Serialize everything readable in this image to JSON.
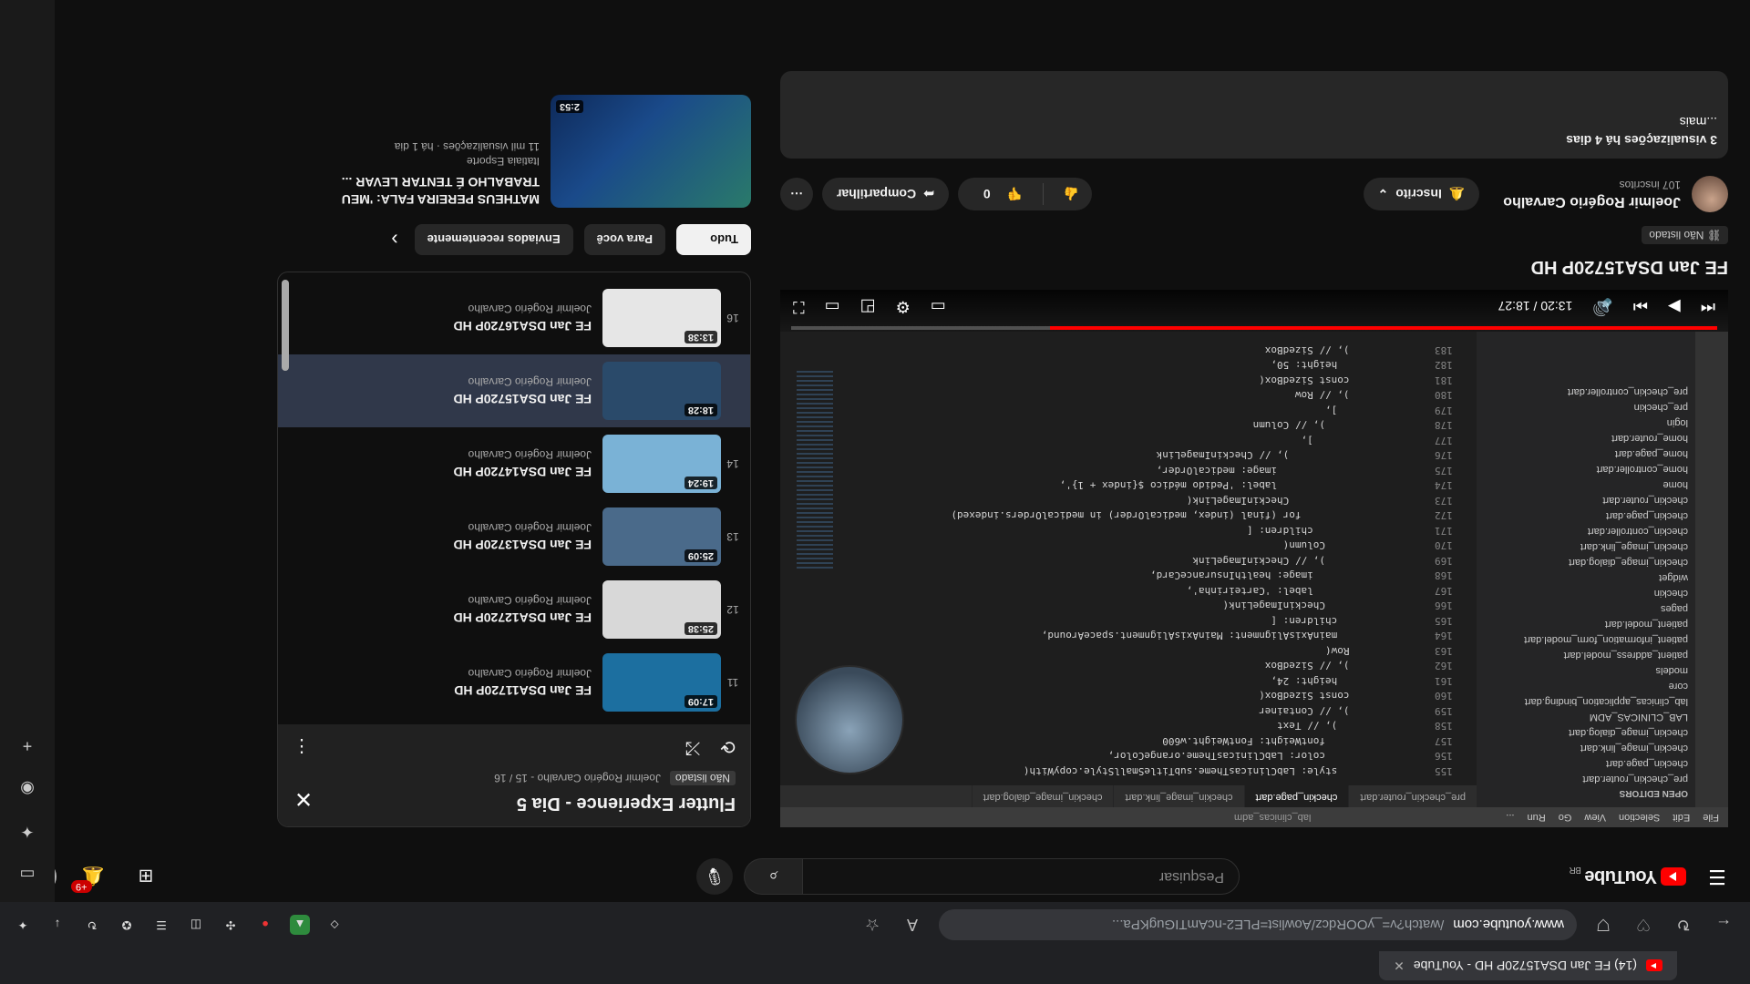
{
  "browser": {
    "tab_title": "(14) FE Jan DSA15720P HD - YouTube",
    "url_host": "www.youtube.com",
    "url_path": "/watch?v=_yOORdcz/Aowlist=PLE2-ncAmTIGugKPa..."
  },
  "header": {
    "logo_text": "YouTube",
    "region": "BR",
    "search_placeholder": "Pesquisar",
    "notifications_count": "+9"
  },
  "player": {
    "menu": [
      "File",
      "Edit",
      "Selection",
      "View",
      "Go",
      "Run",
      "..."
    ],
    "window_title": "lab_clinicas_adm",
    "explorer_header": "OPEN EDITORS",
    "explorer_items": [
      "pre_checkin_router.dart",
      "checkin_page.dart",
      "checkin_image_link.dart",
      "checkin_image_dialog.dart",
      "LAB_CLINICAS_ADM",
      "lab_clinicas_application_binding.dart",
      "core",
      "models",
      "patient_address_model.dart",
      "patient_information_form_model.dart",
      "patient_model.dart",
      "pages",
      "checkin",
      "widget",
      "checkin_image_dialog.dart",
      "checkin_image_link.dart",
      "checkin_controller.dart",
      "checkin_page.dart",
      "checkin_router.dart",
      "home",
      "home_controller.dart",
      "home_page.dart",
      "home_router.dart",
      "login",
      "pre_checkin",
      "pre_checkin_controller.dart"
    ],
    "editor_tabs": [
      "pre_checkin_router.dart",
      "checkin_page.dart",
      "checkin_image_link.dart",
      "checkin_image_dialog.dart"
    ],
    "code_lines": [
      {
        "n": "155",
        "t": "              style: LabClinicasTheme.subTitleSmallStyle.copyWith("
      },
      {
        "n": "156",
        "t": "                color: LabClinicasTheme.orangeColor,"
      },
      {
        "n": "157",
        "t": "                fontWeight: FontWeight.w600"
      },
      {
        "n": "158",
        "t": "              ), // Text"
      },
      {
        "n": "159",
        "t": "            ), // Container"
      },
      {
        "n": "160",
        "t": "            const SizedBox("
      },
      {
        "n": "161",
        "t": "              height: 24,"
      },
      {
        "n": "162",
        "t": "            ), // SizedBox"
      },
      {
        "n": "163",
        "t": "            Row("
      },
      {
        "n": "164",
        "t": "              mainAxisAlignment: MainAxisAlignment.spaceAround,"
      },
      {
        "n": "165",
        "t": "              children: ["
      },
      {
        "n": "166",
        "t": "                CheckinImageLink("
      },
      {
        "n": "167",
        "t": "                  label: 'Carteirinha',"
      },
      {
        "n": "168",
        "t": "                  image: healthInsuranceCard,"
      },
      {
        "n": "169",
        "t": "                ), // CheckinImageLink"
      },
      {
        "n": "170",
        "t": "                Column("
      },
      {
        "n": "171",
        "t": "                  children: ["
      },
      {
        "n": "172",
        "t": "                    for (final (index, medicalOrder) in medicalOrders.indexed)"
      },
      {
        "n": "173",
        "t": "                      CheckinImageLink("
      },
      {
        "n": "174",
        "t": "                        label: 'Pedido médico ${index + 1}',"
      },
      {
        "n": "175",
        "t": "                        image: medicalOrder,"
      },
      {
        "n": "176",
        "t": "                      ), // CheckinImageLink"
      },
      {
        "n": "177",
        "t": "                  ],"
      },
      {
        "n": "178",
        "t": "                ), // Column"
      },
      {
        "n": "179",
        "t": "              ],"
      },
      {
        "n": "180",
        "t": "            ), // Row"
      },
      {
        "n": "181",
        "t": "            const SizedBox("
      },
      {
        "n": "182",
        "t": "              height: 50,"
      },
      {
        "n": "183",
        "t": "            ), // SizedBox"
      }
    ],
    "time": "13:20 / 18:27",
    "progress": 0.72
  },
  "video": {
    "title": "FE Jan DSA15720P HD",
    "visibility": "Não listado",
    "channel": "Joelmir Rogério Carvalho",
    "subscribers": "107 inscritos",
    "subscribed_label": "Inscrito",
    "likes": "",
    "dislike_count": "0",
    "share_label": "Compartilhar",
    "description_meta": "3 visualizações  há 4 dias",
    "description_more": "...mais"
  },
  "playlist": {
    "title": "Flutter Experience - Dia 5",
    "visibility": "Não listado",
    "position": "Joelmir Rogério Carvalho - 15 / 16",
    "items": [
      {
        "num": "11",
        "title": "FE Jan DSA11720P HD",
        "channel": "Joelmir Rogério Carvalho",
        "duration": "17:09",
        "active": false
      },
      {
        "num": "12",
        "title": "FE Jan DSA12720P HD",
        "channel": "Joelmir Rogério Carvalho",
        "duration": "25:38",
        "active": false
      },
      {
        "num": "13",
        "title": "FE Jan DSA13720P HD",
        "channel": "Joelmir Rogério Carvalho",
        "duration": "25:09",
        "active": false
      },
      {
        "num": "14",
        "title": "FE Jan DSA14720P HD",
        "channel": "Joelmir Rogério Carvalho",
        "duration": "19:24",
        "active": false
      },
      {
        "num": "",
        "title": "FE Jan DSA15720P HD",
        "channel": "Joelmir Rogério Carvalho",
        "duration": "18:28",
        "active": true
      },
      {
        "num": "16",
        "title": "FE Jan DSA16720P HD",
        "channel": "Joelmir Rogério Carvalho",
        "duration": "13:38",
        "active": false
      }
    ]
  },
  "chips": {
    "first": "Tudo",
    "second": "Para você",
    "third": "Enviados recentemente"
  },
  "recommended": {
    "title_line1": "MATHEUS PEREIRA FALA: 'MEU",
    "title_line2": "TRABALHO É TENTAR LEVAR ...",
    "channel": "Itatiaia Esporte",
    "meta": "11 mil visualizações · há 1 dia",
    "duration": "2:53"
  }
}
